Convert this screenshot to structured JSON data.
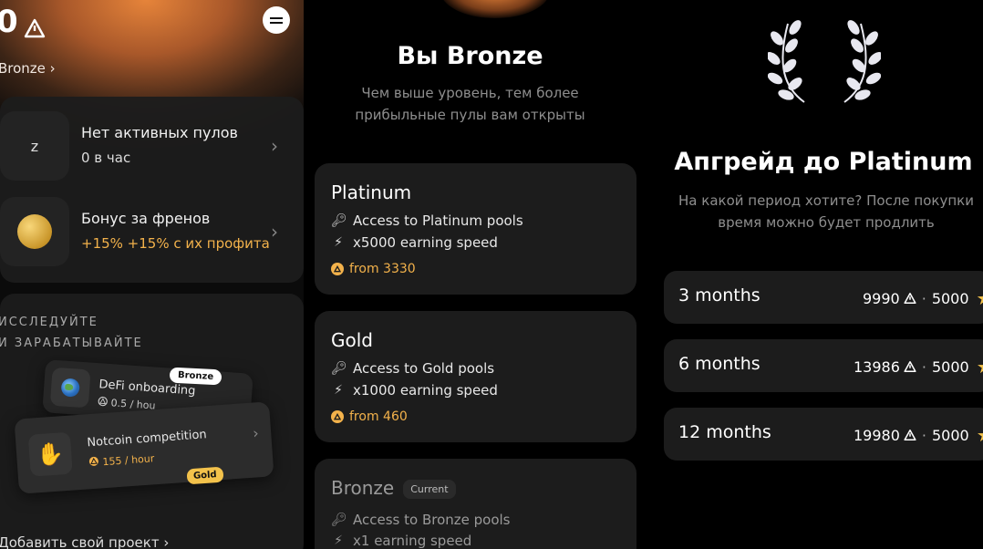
{
  "panel1": {
    "balance": "0",
    "level_link": "Bronze ›",
    "pools_row": {
      "icon_text": "z",
      "title": "Нет активных пулов",
      "subtitle": "0 в час"
    },
    "friends_row": {
      "title": "Бонус за френов",
      "subtitle": "+15% +15% с их профита"
    },
    "explore_title_line1": "ИССЛЕДУЙТЕ",
    "explore_title_line2": "И ЗАРАБАТЫВАЙТЕ",
    "mini_card_1": {
      "title": "DeFi onboarding",
      "rate": "0.5 / hou",
      "badge": "Bronze"
    },
    "mini_card_2": {
      "title": "Notcoin competition",
      "rate": "155 / hour",
      "badge": "Gold"
    },
    "add_project": "Добавить свой проект ›"
  },
  "panel2": {
    "title": "Вы Bronze",
    "subtitle_line1": "Чем выше уровень, тем более",
    "subtitle_line2": "прибыльные пулы вам открыты",
    "levels": [
      {
        "name": "Platinum",
        "access": "Access to Platinum pools",
        "speed": "x5000 earning speed",
        "price": "from 3330"
      },
      {
        "name": "Gold",
        "access": "Access to Gold pools",
        "speed": "x1000 earning speed",
        "price": "from 460"
      },
      {
        "name": "Bronze",
        "badge": "Current",
        "access": "Access to Bronze pools",
        "speed": "x1 earning speed"
      }
    ]
  },
  "panel3": {
    "title": "Апгрейд до Platinum",
    "subtitle_line1": "На какой период хотите? После покупки",
    "subtitle_line2": "время можно будет продлить",
    "plans": [
      {
        "duration": "3 months",
        "coins": "9990",
        "stars": "5000"
      },
      {
        "duration": "6 months",
        "coins": "13986",
        "stars": "5000"
      },
      {
        "duration": "12 months",
        "coins": "19980",
        "stars": "5000"
      }
    ],
    "separator": "·"
  },
  "colors": {
    "accent_orange": "#f3b24b",
    "gold_badge": "#f3c24b",
    "card_bg": "#1c1c1c"
  },
  "icons": [
    "warning-triangle-icon",
    "menu-icon",
    "chevron-right-icon",
    "coin-icon",
    "key-icon",
    "bolt-icon",
    "globe-icon",
    "waving-hand-icon",
    "star-icon",
    "laurel-icon"
  ]
}
